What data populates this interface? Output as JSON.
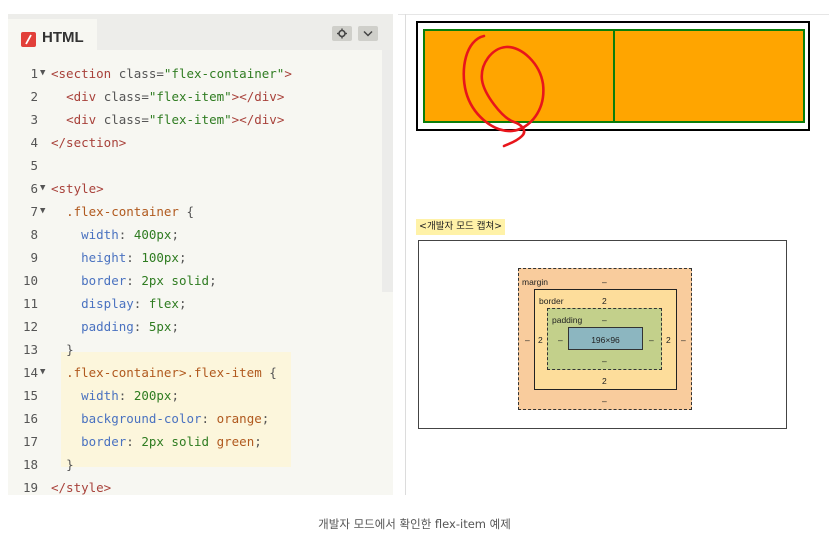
{
  "editor": {
    "tab_label": "HTML",
    "code_lines": [
      {
        "n": "1",
        "fold": true,
        "tokens": [
          [
            "t-tag",
            "<section "
          ],
          [
            "t-attr",
            "class"
          ],
          [
            "t-punc",
            "="
          ],
          [
            "t-str",
            "\"flex-container\""
          ],
          [
            "t-tag",
            ">"
          ]
        ]
      },
      {
        "n": "2",
        "fold": false,
        "tokens": [
          [
            "",
            "  "
          ],
          [
            "t-tag",
            "<div "
          ],
          [
            "t-attr",
            "class"
          ],
          [
            "t-punc",
            "="
          ],
          [
            "t-str",
            "\"flex-item\""
          ],
          [
            "t-tag",
            "></div>"
          ]
        ]
      },
      {
        "n": "3",
        "fold": false,
        "tokens": [
          [
            "",
            "  "
          ],
          [
            "t-tag",
            "<div "
          ],
          [
            "t-attr",
            "class"
          ],
          [
            "t-punc",
            "="
          ],
          [
            "t-str",
            "\"flex-item\""
          ],
          [
            "t-tag",
            "></div>"
          ]
        ]
      },
      {
        "n": "4",
        "fold": false,
        "tokens": [
          [
            "t-tag",
            "</section>"
          ]
        ]
      },
      {
        "n": "5",
        "fold": false,
        "tokens": []
      },
      {
        "n": "6",
        "fold": true,
        "tokens": [
          [
            "t-tag",
            "<style>"
          ]
        ]
      },
      {
        "n": "7",
        "fold": true,
        "tokens": [
          [
            "",
            "  "
          ],
          [
            "t-sel",
            ".flex-container"
          ],
          [
            "t-punc",
            " {"
          ]
        ]
      },
      {
        "n": "8",
        "fold": false,
        "tokens": [
          [
            "",
            "    "
          ],
          [
            "t-prop",
            "width"
          ],
          [
            "t-punc",
            ": "
          ],
          [
            "t-val",
            "400px"
          ],
          [
            "t-punc",
            ";"
          ]
        ]
      },
      {
        "n": "9",
        "fold": false,
        "tokens": [
          [
            "",
            "    "
          ],
          [
            "t-prop",
            "height"
          ],
          [
            "t-punc",
            ": "
          ],
          [
            "t-val",
            "100px"
          ],
          [
            "t-punc",
            ";"
          ]
        ]
      },
      {
        "n": "10",
        "fold": false,
        "tokens": [
          [
            "",
            "    "
          ],
          [
            "t-prop",
            "border"
          ],
          [
            "t-punc",
            ": "
          ],
          [
            "t-val",
            "2px solid"
          ],
          [
            "t-punc",
            ";"
          ]
        ]
      },
      {
        "n": "11",
        "fold": false,
        "tokens": [
          [
            "",
            "    "
          ],
          [
            "t-prop",
            "display"
          ],
          [
            "t-punc",
            ": "
          ],
          [
            "t-val",
            "flex"
          ],
          [
            "t-punc",
            ";"
          ]
        ]
      },
      {
        "n": "12",
        "fold": false,
        "tokens": [
          [
            "",
            "    "
          ],
          [
            "t-prop",
            "padding"
          ],
          [
            "t-punc",
            ": "
          ],
          [
            "t-val",
            "5px"
          ],
          [
            "t-punc",
            ";"
          ]
        ]
      },
      {
        "n": "13",
        "fold": false,
        "tokens": [
          [
            "",
            "  "
          ],
          [
            "t-punc",
            "}"
          ]
        ]
      },
      {
        "n": "14",
        "fold": true,
        "tokens": [
          [
            "",
            "  "
          ],
          [
            "t-sel",
            ".flex-container>.flex-item"
          ],
          [
            "t-punc",
            " {"
          ]
        ]
      },
      {
        "n": "15",
        "fold": false,
        "tokens": [
          [
            "",
            "    "
          ],
          [
            "t-prop",
            "width"
          ],
          [
            "t-punc",
            ": "
          ],
          [
            "t-val",
            "200px"
          ],
          [
            "t-punc",
            ";"
          ]
        ]
      },
      {
        "n": "16",
        "fold": false,
        "tokens": [
          [
            "",
            "    "
          ],
          [
            "t-prop",
            "background-color"
          ],
          [
            "t-punc",
            ": "
          ],
          [
            "t-kw",
            "orange"
          ],
          [
            "t-punc",
            ";"
          ]
        ]
      },
      {
        "n": "17",
        "fold": false,
        "tokens": [
          [
            "",
            "    "
          ],
          [
            "t-prop",
            "border"
          ],
          [
            "t-punc",
            ": "
          ],
          [
            "t-val",
            "2px solid "
          ],
          [
            "t-kw",
            "green"
          ],
          [
            "t-punc",
            ";"
          ]
        ]
      },
      {
        "n": "18",
        "fold": false,
        "tokens": [
          [
            "",
            "  "
          ],
          [
            "t-punc",
            "}"
          ]
        ]
      },
      {
        "n": "19",
        "fold": false,
        "tokens": [
          [
            "t-tag",
            "</style>"
          ]
        ]
      }
    ],
    "icons": {
      "logo": "html-logo-icon",
      "gear": "gear-icon",
      "dropdown": "chevron-down-icon"
    }
  },
  "preview": {
    "flex_item_color": "#ffa500",
    "flex_item_border_color": "#0a7e0a",
    "annotation_color": "#e8151b"
  },
  "devtools": {
    "caption": "<개발자 모드 캡쳐>",
    "margin_label": "margin",
    "margin_top": "–",
    "margin_bottom": "–",
    "margin_left": "–",
    "margin_right": "–",
    "border_label": "border",
    "border_top": "2",
    "border_bottom": "2",
    "border_left": "2",
    "border_right": "2",
    "padding_label": "padding",
    "padding_top": "–",
    "padding_bottom": "–",
    "padding_left": "–",
    "padding_right": "–",
    "content_size": "196×96"
  },
  "figure_caption": "개발자 모드에서 확인한 flex-item 예제"
}
